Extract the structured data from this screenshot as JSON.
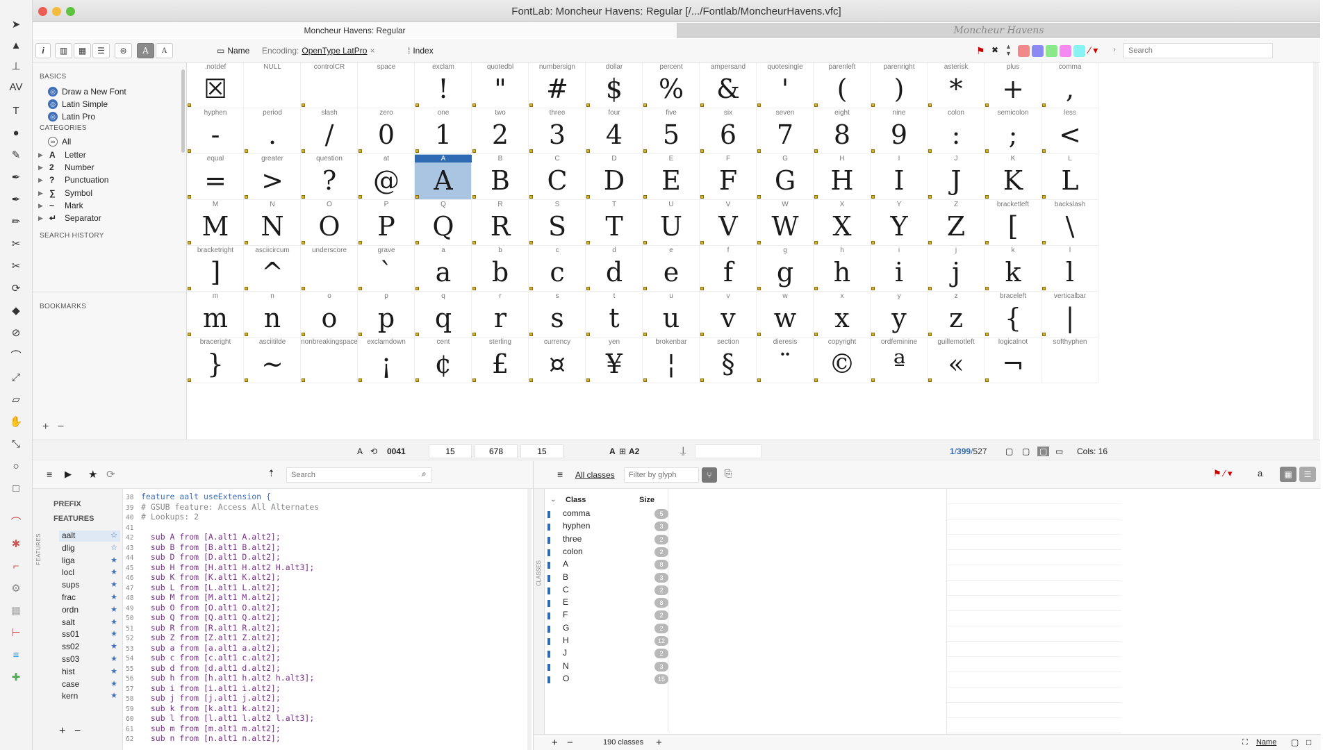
{
  "app": {
    "title": "FontLab: Moncheur Havens: Regular  [/.../Fontlab/MoncheurHavens.vfc]",
    "tab_active": "Moncheur Havens: Regular",
    "tab_preview": "Moncheur Havens"
  },
  "fontbar": {
    "name_label": "Name",
    "encoding_label": "Encoding:",
    "encoding_value": "OpenType LatPro",
    "index_label": "Index",
    "search_placeholder": "Search",
    "swatches": [
      "#f08a8a",
      "#8a8af2",
      "#8ae88a",
      "#f28af2",
      "#8af2f2"
    ]
  },
  "sidebar": {
    "basics_heading": "BASICS",
    "basics": [
      "Draw a New Font",
      "Latin Simple",
      "Latin Pro"
    ],
    "categories_heading": "CATEGORIES",
    "all_label": "All",
    "categories": [
      {
        "icon": "A",
        "label": "Letter"
      },
      {
        "icon": "2",
        "label": "Number"
      },
      {
        "icon": "?",
        "label": "Punctuation"
      },
      {
        "icon": "∑",
        "label": "Symbol"
      },
      {
        "icon": "~",
        "label": "Mark"
      },
      {
        "icon": "↵",
        "label": "Separator"
      }
    ],
    "search_history_heading": "SEARCH HISTORY",
    "bookmarks_heading": "BOOKMARKS",
    "add_label": "+",
    "remove_label": "−"
  },
  "glyphs": [
    {
      "n": ".notdef",
      "g": "☒"
    },
    {
      "n": "NULL",
      "g": ""
    },
    {
      "n": "controlCR",
      "g": ""
    },
    {
      "n": "space",
      "g": ""
    },
    {
      "n": "exclam",
      "g": "!"
    },
    {
      "n": "quotedbl",
      "g": "\""
    },
    {
      "n": "numbersign",
      "g": "#"
    },
    {
      "n": "dollar",
      "g": "$"
    },
    {
      "n": "percent",
      "g": "%"
    },
    {
      "n": "ampersand",
      "g": "&"
    },
    {
      "n": "quotesingle",
      "g": "'"
    },
    {
      "n": "parenleft",
      "g": "("
    },
    {
      "n": "parenright",
      "g": ")"
    },
    {
      "n": "asterisk",
      "g": "*"
    },
    {
      "n": "plus",
      "g": "+"
    },
    {
      "n": "comma",
      "g": ","
    },
    {
      "n": "hyphen",
      "g": "-"
    },
    {
      "n": "period",
      "g": "."
    },
    {
      "n": "slash",
      "g": "/"
    },
    {
      "n": "zero",
      "g": "0"
    },
    {
      "n": "one",
      "g": "1"
    },
    {
      "n": "two",
      "g": "2"
    },
    {
      "n": "three",
      "g": "3"
    },
    {
      "n": "four",
      "g": "4"
    },
    {
      "n": "five",
      "g": "5"
    },
    {
      "n": "six",
      "g": "6"
    },
    {
      "n": "seven",
      "g": "7"
    },
    {
      "n": "eight",
      "g": "8"
    },
    {
      "n": "nine",
      "g": "9"
    },
    {
      "n": "colon",
      "g": ":"
    },
    {
      "n": "semicolon",
      "g": ";"
    },
    {
      "n": "less",
      "g": "<"
    },
    {
      "n": "equal",
      "g": "="
    },
    {
      "n": "greater",
      "g": ">"
    },
    {
      "n": "question",
      "g": "?"
    },
    {
      "n": "at",
      "g": "@"
    },
    {
      "n": "A",
      "g": "A"
    },
    {
      "n": "B",
      "g": "B"
    },
    {
      "n": "C",
      "g": "C"
    },
    {
      "n": "D",
      "g": "D"
    },
    {
      "n": "E",
      "g": "E"
    },
    {
      "n": "F",
      "g": "F"
    },
    {
      "n": "G",
      "g": "G"
    },
    {
      "n": "H",
      "g": "H"
    },
    {
      "n": "I",
      "g": "I"
    },
    {
      "n": "J",
      "g": "J"
    },
    {
      "n": "K",
      "g": "K"
    },
    {
      "n": "L",
      "g": "L"
    },
    {
      "n": "M",
      "g": "M"
    },
    {
      "n": "N",
      "g": "N"
    },
    {
      "n": "O",
      "g": "O"
    },
    {
      "n": "P",
      "g": "P"
    },
    {
      "n": "Q",
      "g": "Q"
    },
    {
      "n": "R",
      "g": "R"
    },
    {
      "n": "S",
      "g": "S"
    },
    {
      "n": "T",
      "g": "T"
    },
    {
      "n": "U",
      "g": "U"
    },
    {
      "n": "V",
      "g": "V"
    },
    {
      "n": "W",
      "g": "W"
    },
    {
      "n": "X",
      "g": "X"
    },
    {
      "n": "Y",
      "g": "Y"
    },
    {
      "n": "Z",
      "g": "Z"
    },
    {
      "n": "bracketleft",
      "g": "["
    },
    {
      "n": "backslash",
      "g": "\\"
    },
    {
      "n": "bracketright",
      "g": "]"
    },
    {
      "n": "asciicircum",
      "g": "^"
    },
    {
      "n": "underscore",
      "g": ""
    },
    {
      "n": "grave",
      "g": "`"
    },
    {
      "n": "a",
      "g": "a"
    },
    {
      "n": "b",
      "g": "b"
    },
    {
      "n": "c",
      "g": "c"
    },
    {
      "n": "d",
      "g": "d"
    },
    {
      "n": "e",
      "g": "e"
    },
    {
      "n": "f",
      "g": "f"
    },
    {
      "n": "g",
      "g": "g"
    },
    {
      "n": "h",
      "g": "h"
    },
    {
      "n": "i",
      "g": "i"
    },
    {
      "n": "j",
      "g": "j"
    },
    {
      "n": "k",
      "g": "k"
    },
    {
      "n": "l",
      "g": "l"
    },
    {
      "n": "m",
      "g": "m"
    },
    {
      "n": "n",
      "g": "n"
    },
    {
      "n": "o",
      "g": "o"
    },
    {
      "n": "p",
      "g": "p"
    },
    {
      "n": "q",
      "g": "q"
    },
    {
      "n": "r",
      "g": "r"
    },
    {
      "n": "s",
      "g": "s"
    },
    {
      "n": "t",
      "g": "t"
    },
    {
      "n": "u",
      "g": "u"
    },
    {
      "n": "v",
      "g": "v"
    },
    {
      "n": "w",
      "g": "w"
    },
    {
      "n": "x",
      "g": "x"
    },
    {
      "n": "y",
      "g": "y"
    },
    {
      "n": "z",
      "g": "z"
    },
    {
      "n": "braceleft",
      "g": "{"
    },
    {
      "n": "verticalbar",
      "g": "|"
    },
    {
      "n": "braceright",
      "g": "}"
    },
    {
      "n": "asciitilde",
      "g": "~"
    },
    {
      "n": "nonbreakingspace",
      "g": ""
    },
    {
      "n": "exclamdown",
      "g": "¡"
    },
    {
      "n": "cent",
      "g": "¢"
    },
    {
      "n": "sterling",
      "g": "£"
    },
    {
      "n": "currency",
      "g": "¤"
    },
    {
      "n": "yen",
      "g": "¥"
    },
    {
      "n": "brokenbar",
      "g": "¦"
    },
    {
      "n": "section",
      "g": "§"
    },
    {
      "n": "dieresis",
      "g": "¨"
    },
    {
      "n": "copyright",
      "g": "©"
    },
    {
      "n": "ordfeminine",
      "g": "ª"
    },
    {
      "n": "guillemotleft",
      "g": "«"
    },
    {
      "n": "logicalnot",
      "g": "¬"
    },
    {
      "n": "softhyphen",
      "g": ""
    }
  ],
  "selected_glyph": "A",
  "status": {
    "glyph": "A",
    "unicode": "0041",
    "lsb": "15",
    "advance": "678",
    "rsb": "15",
    "names": [
      "A",
      "A2"
    ],
    "count_current": "1",
    "count_selected": "399",
    "count_total": "527",
    "cols_label": "Cols: 16"
  },
  "features_panel": {
    "search_placeholder": "Search",
    "prefix_label": "PREFIX",
    "features_label": "FEATURES",
    "side_label": "FEATURES",
    "items": [
      "aalt",
      "dlig",
      "liga",
      "locl",
      "sups",
      "frac",
      "ordn",
      "salt",
      "ss01",
      "ss02",
      "ss03",
      "hist",
      "case",
      "kern"
    ],
    "starred": [
      false,
      false,
      true,
      true,
      true,
      true,
      true,
      true,
      true,
      true,
      true,
      true,
      true,
      true
    ],
    "code": [
      {
        "ln": "38",
        "t": "feature aalt useExtension {"
      },
      {
        "ln": "39",
        "t": "# GSUB feature: Access All Alternates"
      },
      {
        "ln": "40",
        "t": "# Lookups: 2"
      },
      {
        "ln": "41",
        "t": ""
      },
      {
        "ln": "42",
        "t": "  sub A from [A.alt1 A.alt2];"
      },
      {
        "ln": "43",
        "t": "  sub B from [B.alt1 B.alt2];"
      },
      {
        "ln": "44",
        "t": "  sub D from [D.alt1 D.alt2];"
      },
      {
        "ln": "45",
        "t": "  sub H from [H.alt1 H.alt2 H.alt3];"
      },
      {
        "ln": "46",
        "t": "  sub K from [K.alt1 K.alt2];"
      },
      {
        "ln": "47",
        "t": "  sub L from [L.alt1 L.alt2];"
      },
      {
        "ln": "48",
        "t": "  sub M from [M.alt1 M.alt2];"
      },
      {
        "ln": "49",
        "t": "  sub O from [O.alt1 O.alt2];"
      },
      {
        "ln": "50",
        "t": "  sub Q from [Q.alt1 Q.alt2];"
      },
      {
        "ln": "51",
        "t": "  sub R from [R.alt1 R.alt2];"
      },
      {
        "ln": "52",
        "t": "  sub Z from [Z.alt1 Z.alt2];"
      },
      {
        "ln": "53",
        "t": "  sub a from [a.alt1 a.alt2];"
      },
      {
        "ln": "54",
        "t": "  sub c from [c.alt1 c.alt2];"
      },
      {
        "ln": "55",
        "t": "  sub d from [d.alt1 d.alt2];"
      },
      {
        "ln": "56",
        "t": "  sub h from [h.alt1 h.alt2 h.alt3];"
      },
      {
        "ln": "57",
        "t": "  sub i from [i.alt1 i.alt2];"
      },
      {
        "ln": "58",
        "t": "  sub j from [j.alt1 j.alt2];"
      },
      {
        "ln": "59",
        "t": "  sub k from [k.alt1 k.alt2];"
      },
      {
        "ln": "60",
        "t": "  sub l from [l.alt1 l.alt2 l.alt3];"
      },
      {
        "ln": "61",
        "t": "  sub m from [m.alt1 m.alt2];"
      },
      {
        "ln": "62",
        "t": "  sub n from [n.alt1 n.alt2];"
      }
    ]
  },
  "classes_panel": {
    "all_classes_label": "All classes",
    "filter_placeholder": "Filter by glyph",
    "side_label": "CLASSES",
    "col_class": "Class",
    "col_size": "Size",
    "rows": [
      {
        "name": "comma",
        "size": "5"
      },
      {
        "name": "hyphen",
        "size": "3"
      },
      {
        "name": "three",
        "size": "2"
      },
      {
        "name": "colon",
        "size": "2"
      },
      {
        "name": "A",
        "size": "8"
      },
      {
        "name": "B",
        "size": "3"
      },
      {
        "name": "C",
        "size": "2"
      },
      {
        "name": "E",
        "size": "8"
      },
      {
        "name": "F",
        "size": "2"
      },
      {
        "name": "G",
        "size": "2"
      },
      {
        "name": "H",
        "size": "12"
      },
      {
        "name": "J",
        "size": "2"
      },
      {
        "name": "N",
        "size": "3"
      },
      {
        "name": "O",
        "size": "15"
      }
    ],
    "count_label": "190 classes",
    "name_sort_label": "Name"
  }
}
